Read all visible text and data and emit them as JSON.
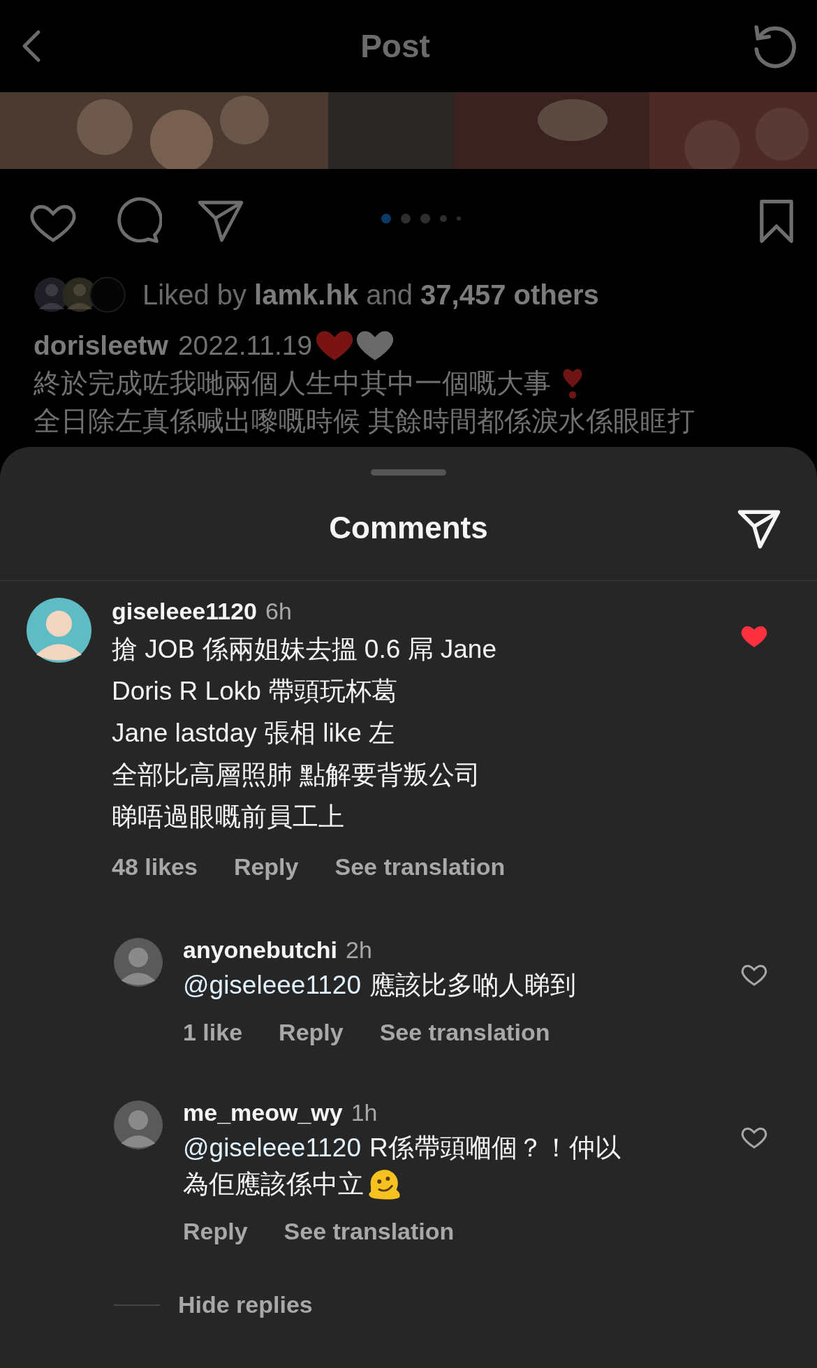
{
  "header": {
    "title": "Post"
  },
  "carousel": {
    "dots": [
      {
        "selected": true
      },
      {
        "selected": false
      },
      {
        "selected": false
      },
      {
        "selected": false
      },
      {
        "selected": false
      }
    ]
  },
  "likes": {
    "text": "Liked by **lamk.hk** and **37,457 others**"
  },
  "caption": {
    "username": "dorisleetw",
    "date": "2022.11.19",
    "emojis": [
      {
        "kind": "heart",
        "color": "#7a1414"
      },
      {
        "kind": "heart",
        "color": "#6a6a6a"
      }
    ],
    "lines": [
      {
        "text": "終於完成咗我哋兩個人生中其中一個嘅大事",
        "trail": {
          "kind": "heart_exclamation"
        }
      },
      {
        "text": "全日除左真係喊出嚟嘅時候 其餘時間都係淚水係眼眶打"
      }
    ]
  },
  "sheet": {
    "title": "Comments"
  },
  "comments": [
    {
      "username": "giseleee1120",
      "time": "6h",
      "lines": [
        "搶 JOB 係兩姐妹去搵 0.6 屌 Jane",
        "Doris R Lokb 帶頭玩杯葛",
        "Jane lastday 張相 like 左",
        "全部比高層照肺 點解要背叛公司",
        "睇唔過眼嘅前員工上"
      ],
      "likes": "48 likes",
      "reply": "Reply",
      "translate": "See translation",
      "liked": true,
      "replies": [
        {
          "username": "anyonebutchi",
          "time": "2h",
          "mention": "@giseleee1120",
          "lines": [
            "應該比多啲人睇到"
          ],
          "likes": "1 like",
          "reply": "Reply",
          "translate": "See translation",
          "liked": false
        },
        {
          "username": "me_meow_wy",
          "time": "1h",
          "mention": "@giseleee1120",
          "lines": [
            "R係帶頭嗰個？！仲以",
            "為佢應該係中立"
          ],
          "trail": {
            "kind": "melting_face"
          },
          "reply": "Reply",
          "translate": "See translation",
          "liked": false
        }
      ]
    }
  ],
  "hide_replies": "Hide replies"
}
